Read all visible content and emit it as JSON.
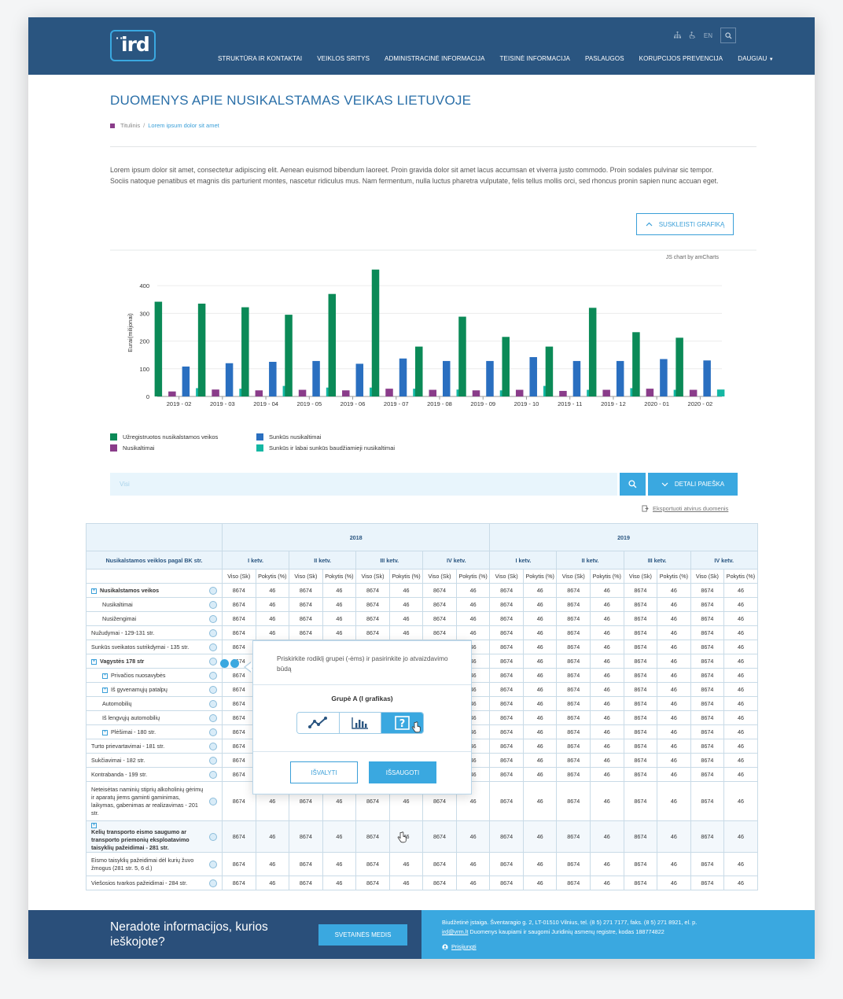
{
  "header": {
    "logo_text": "ird",
    "lang": "EN",
    "nav": [
      "STRUKTŪRA IR KONTAKTAI",
      "VEIKLOS SRITYS",
      "ADMINISTRACINĖ INFORMACIJA",
      "TEISINĖ INFORMACIJA",
      "PASLAUGOS",
      "KORUPCIJOS PREVENCIJA",
      "DAUGIAU"
    ]
  },
  "page": {
    "title": "DUOMENYS APIE NUSIKALSTAMAS VEIKAS LIETUVOJE",
    "breadcrumb_home": "Titulinis",
    "breadcrumb_sep": "/",
    "breadcrumb_current": "Lorem ipsum dolor sit amet",
    "intro": "Lorem ipsum dolor sit amet, consectetur adipiscing elit. Aenean euismod bibendum laoreet. Proin gravida dolor sit amet lacus accumsan et viverra justo commodo. Proin sodales pulvinar sic tempor. Sociis natoque penatibus et magnis dis parturient montes, nascetur ridiculus mus. Nam fermentum, nulla luctus pharetra vulputate, felis tellus mollis orci, sed rhoncus pronin sapien nunc accuan eget.",
    "collapse_label": "SUSKLEISTI GRAFIKĄ"
  },
  "chart_data": {
    "type": "bar",
    "credit": "JS chart by amCharts",
    "ylabel": "Eurai(milijonai)",
    "ylim": [
      0,
      460
    ],
    "yticks": [
      0,
      100,
      200,
      300,
      400
    ],
    "categories": [
      "2019 - 02",
      "2019 - 03",
      "2019 - 04",
      "2019 - 05",
      "2019 - 06",
      "2019 - 07",
      "2019 - 08",
      "2019 - 09",
      "2019 - 10",
      "2019 - 11",
      "2019 - 12",
      "2020 - 01",
      "2020 - 02"
    ],
    "series": [
      {
        "name": "Užregistruotos nusikalstamos veikos",
        "color": "#0b8a57",
        "values": [
          342,
          335,
          322,
          295,
          370,
          458,
          180,
          288,
          215,
          180,
          320,
          232,
          212
        ]
      },
      {
        "name": "Nusikaltimai",
        "color": "#8a3c8a",
        "values": [
          18,
          25,
          22,
          24,
          22,
          28,
          24,
          22,
          24,
          20,
          24,
          28,
          24
        ]
      },
      {
        "name": "Sunkūs nusikaltimai",
        "color": "#2a6fc0",
        "values": [
          108,
          120,
          125,
          128,
          118,
          137,
          128,
          128,
          142,
          128,
          128,
          135,
          130
        ]
      },
      {
        "name": "Sunkūs ir labai sunkūs baudžiamieji nusikaltimai",
        "color": "#14b7a3",
        "values": [
          30,
          28,
          38,
          32,
          32,
          28,
          25,
          22,
          38,
          24,
          30,
          24,
          25
        ]
      }
    ]
  },
  "search": {
    "placeholder": "Visi",
    "detail_label": "DETALI PAIEŠKA",
    "export_label": "Eksportuoti atvirus duomenis"
  },
  "table": {
    "row_header": "Nusikalstamos veiklos pagal BK str.",
    "years": [
      "2018",
      "2019"
    ],
    "quarters": [
      "I ketv.",
      "II ketv.",
      "III ketv.",
      "IV ketv.",
      "I ketv.",
      "II ketv.",
      "III ketv.",
      "IV ketv."
    ],
    "col_a": "Viso (Sk)",
    "col_b": "Pokytis (%)",
    "val_a": "8674",
    "val_b": "46",
    "rows": [
      {
        "label": "Nusikalstamos veikos",
        "level": 0,
        "bold": true,
        "plus": true
      },
      {
        "label": "Nusikaltimai",
        "level": 1
      },
      {
        "label": "Nusižengimai",
        "level": 1
      },
      {
        "label": "Nužudymai - 129-131 str.",
        "level": 0
      },
      {
        "label": "Sunkūs sveikatos sutrikdymai - 135 str.",
        "level": 0
      },
      {
        "label": "Vagystės 178 str",
        "level": 0,
        "bold": true,
        "plus": true
      },
      {
        "label": "Privačios nuosavybės",
        "level": 1,
        "plus": true
      },
      {
        "label": "Iš gyvenamųjų patalpų",
        "level": 1,
        "plus": true
      },
      {
        "label": "Automobilių",
        "level": 1
      },
      {
        "label": "Iš lengvųjų automobilių",
        "level": 1
      },
      {
        "label": "Plėšimai - 180 str.",
        "level": 1,
        "plus": true
      },
      {
        "label": "Turto prievartavimai - 181 str.",
        "level": 0
      },
      {
        "label": "Sukčiavimai - 182 str.",
        "level": 0
      },
      {
        "label": "Kontrabanda - 199 str.",
        "level": 0
      },
      {
        "label": "Neteisėtas naminių stiprių alkoholinių gėrimų ir aparatų jiems gaminti gaminimas, laikymas, gabenimas ar realizavimas - 201 str.",
        "level": 0,
        "tall": 4
      },
      {
        "label": "Kelių transporto eismo saugumo ar transporto priemonių eksploatavimo taisyklių pažeidimai - 281 str.",
        "level": 0,
        "bold": true,
        "plus": true,
        "tall": 3,
        "hl": true
      },
      {
        "label": "Eismo taisyklių pažeidimai dėl kurių žuvo žmogus (281 str. 5, 6 d.)",
        "level": 0,
        "tall": 2
      },
      {
        "label": "Viešosios tvarkos pažeidimai - 284 str.",
        "level": 0
      }
    ]
  },
  "popup": {
    "message": "Priskirkite rodiklį grupei (-ėms) ir pasirinkite jo atvaizdavimo būdą",
    "group_title": "Grupė A (I grafikas)",
    "clear_label": "IŠVALYTI",
    "save_label": "IŠSAUGOTI",
    "options": [
      "line-chart-icon",
      "bar-chart-icon",
      "question-icon"
    ]
  },
  "footer": {
    "question": "Neradote informacijos, kurios ieškojote?",
    "sitemap_label": "SVETAINĖS MEDIS",
    "address": "Biudžetinė įstaiga. Šventaragio g. 2, LT-01510 Vilnius, tel. (8 5) 271 7177, faks. (8 5) 271 8921, el. p.",
    "email": "ird@vrm.lt",
    "registry": " Duomenys kaupiami ir saugomi Juridinių asmenų registre, kodas 188774822",
    "login": "Prisijungti"
  }
}
